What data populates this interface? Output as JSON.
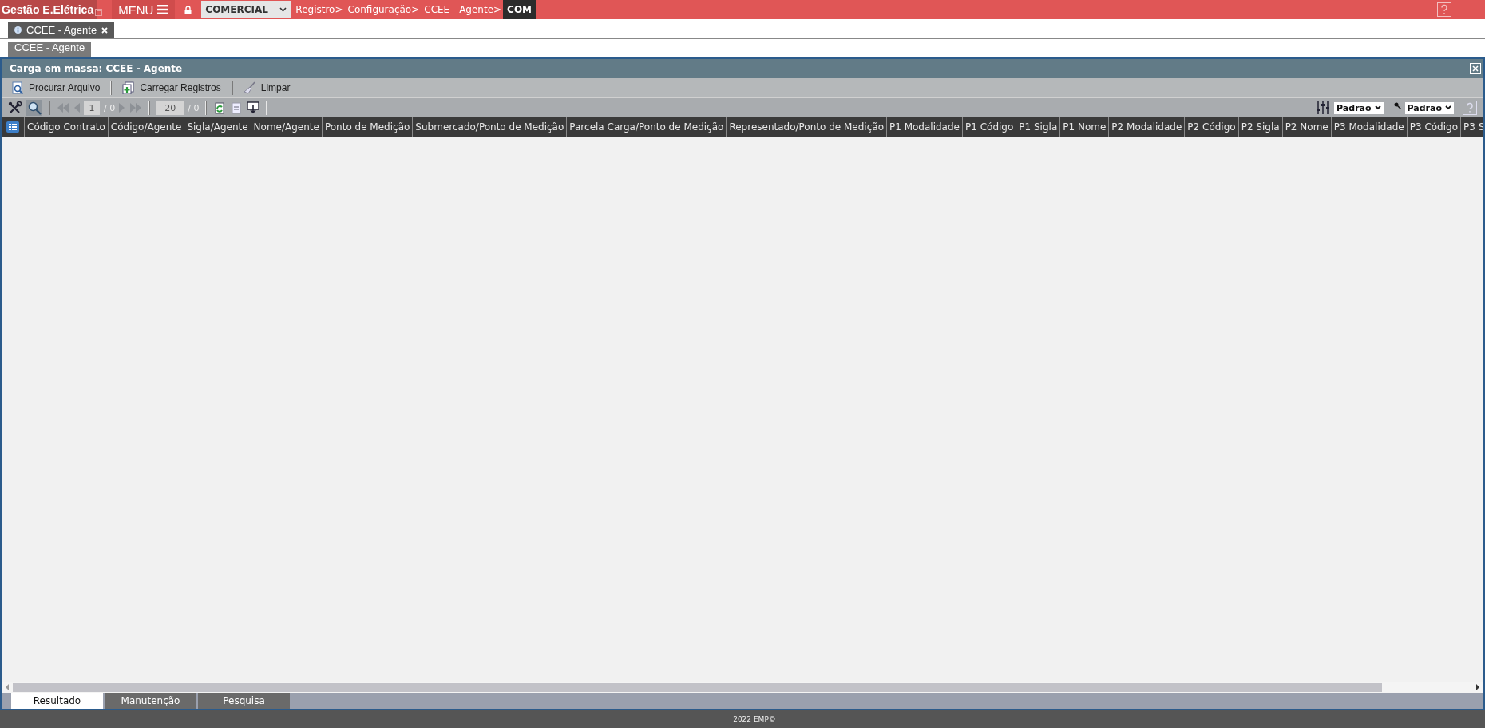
{
  "app_title": "Gestão E.Elétrica",
  "menu_label": "MENU",
  "module_select": {
    "value": "COMERCIAL"
  },
  "breadcrumb": [
    {
      "label": "Registro>"
    },
    {
      "label": "Configuração>"
    },
    {
      "label": "CCEE - Agente>"
    }
  ],
  "breadcrumb_current": "COM",
  "open_tabs": [
    {
      "label": "CCEE - Agente",
      "selected": true
    }
  ],
  "sub_tabs": [
    {
      "label": "CCEE - Agente",
      "selected": true
    }
  ],
  "panel": {
    "title": "Carga em massa: CCEE - Agente",
    "actions": [
      {
        "label": "Procurar Arquivo"
      },
      {
        "label": "Carregar Registros"
      },
      {
        "label": "Limpar"
      }
    ],
    "pager": {
      "page": "1",
      "pages": "/ 0",
      "page_size": "20",
      "total": "/ 0"
    },
    "layout_select": "Padrão",
    "filter_select": "Padrão",
    "columns": [
      "Código Contrato",
      "Código/Agente",
      "Sigla/Agente",
      "Nome/Agente",
      "Ponto de Medição",
      "Submercado/Ponto de Medição",
      "Parcela Carga/Ponto de Medição",
      "Representado/Ponto de Medição",
      "P1 Modalidade",
      "P1 Código",
      "P1 Sigla",
      "P1 Nome",
      "P2 Modalidade",
      "P2 Código",
      "P2 Sigla",
      "P2 Nome",
      "P3 Modalidade",
      "P3 Código",
      "P3 S"
    ],
    "bottom_tabs": [
      {
        "label": "Resultado",
        "selected": true
      },
      {
        "label": "Manutenção",
        "selected": false
      },
      {
        "label": "Pesquisa",
        "selected": false
      }
    ]
  },
  "footer": "2022 EMP©"
}
